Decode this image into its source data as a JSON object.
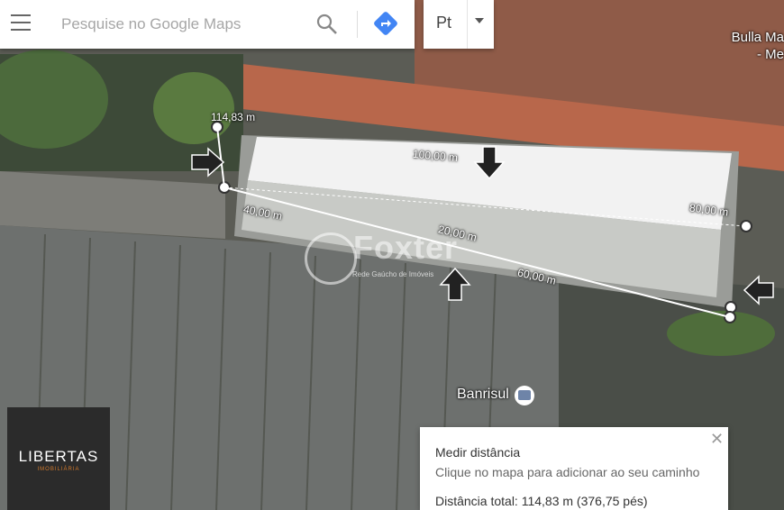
{
  "search": {
    "placeholder": "Pesquise no Google Maps"
  },
  "icons": {
    "menu": "menu-icon",
    "search": "search-icon",
    "directions": "directions-icon",
    "caret": "caret-down-icon",
    "close": "close-icon"
  },
  "language": {
    "selected": "Pt"
  },
  "place_top": {
    "line1": "Bulla Ma",
    "line2": "- Me"
  },
  "measurements": [
    "114,83 m",
    "100,00 m",
    "80,00 m",
    "40,00 m",
    "20,00 m",
    "60,00 m"
  ],
  "map_label": {
    "place": "Banrisul"
  },
  "watermark": {
    "name": "Foxter",
    "tagline": "Rede Gaúcho de Imóveis"
  },
  "logo": {
    "title": "LIBERTAS",
    "subtitle": "IMOBILIÁRIA"
  },
  "measure_panel": {
    "title": "Medir distância",
    "hint": "Clique no mapa para adicionar ao seu caminho",
    "total": "Distância total: 114,83 m (376,75 pés)"
  },
  "colors": {
    "measure_line": "#ffffff",
    "roof_white": "#f2f2f2",
    "tile_roof": "#b5674a",
    "grey_roof": "#777a78",
    "accent_blue": "#4285f4"
  }
}
